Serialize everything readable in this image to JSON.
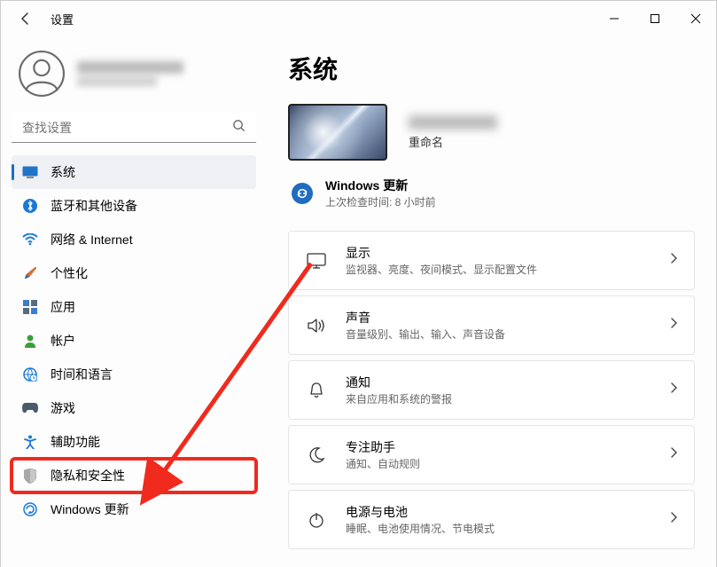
{
  "titlebar": {
    "app_title": "设置"
  },
  "profile": {
    "name_obscured": "",
    "email_obscured": ""
  },
  "search": {
    "placeholder": "查找设置"
  },
  "nav": {
    "items": [
      {
        "label": "系统"
      },
      {
        "label": "蓝牙和其他设备"
      },
      {
        "label": "网络 & Internet"
      },
      {
        "label": "个性化"
      },
      {
        "label": "应用"
      },
      {
        "label": "帐户"
      },
      {
        "label": "时间和语言"
      },
      {
        "label": "游戏"
      },
      {
        "label": "辅助功能"
      },
      {
        "label": "隐私和安全性"
      },
      {
        "label": "Windows 更新"
      }
    ]
  },
  "main": {
    "page_title": "系统",
    "pc_rename_label": "重命名",
    "update": {
      "title": "Windows 更新",
      "subtitle": "上次检查时间: 8 小时前"
    },
    "cards": [
      {
        "title": "显示",
        "subtitle": "监视器、亮度、夜间模式、显示配置文件"
      },
      {
        "title": "声音",
        "subtitle": "音量级别、输出、输入、声音设备"
      },
      {
        "title": "通知",
        "subtitle": "来自应用和系统的警报"
      },
      {
        "title": "专注助手",
        "subtitle": "通知、自动规则"
      },
      {
        "title": "电源与电池",
        "subtitle": "睡眠、电池使用情况、节电模式"
      }
    ]
  }
}
